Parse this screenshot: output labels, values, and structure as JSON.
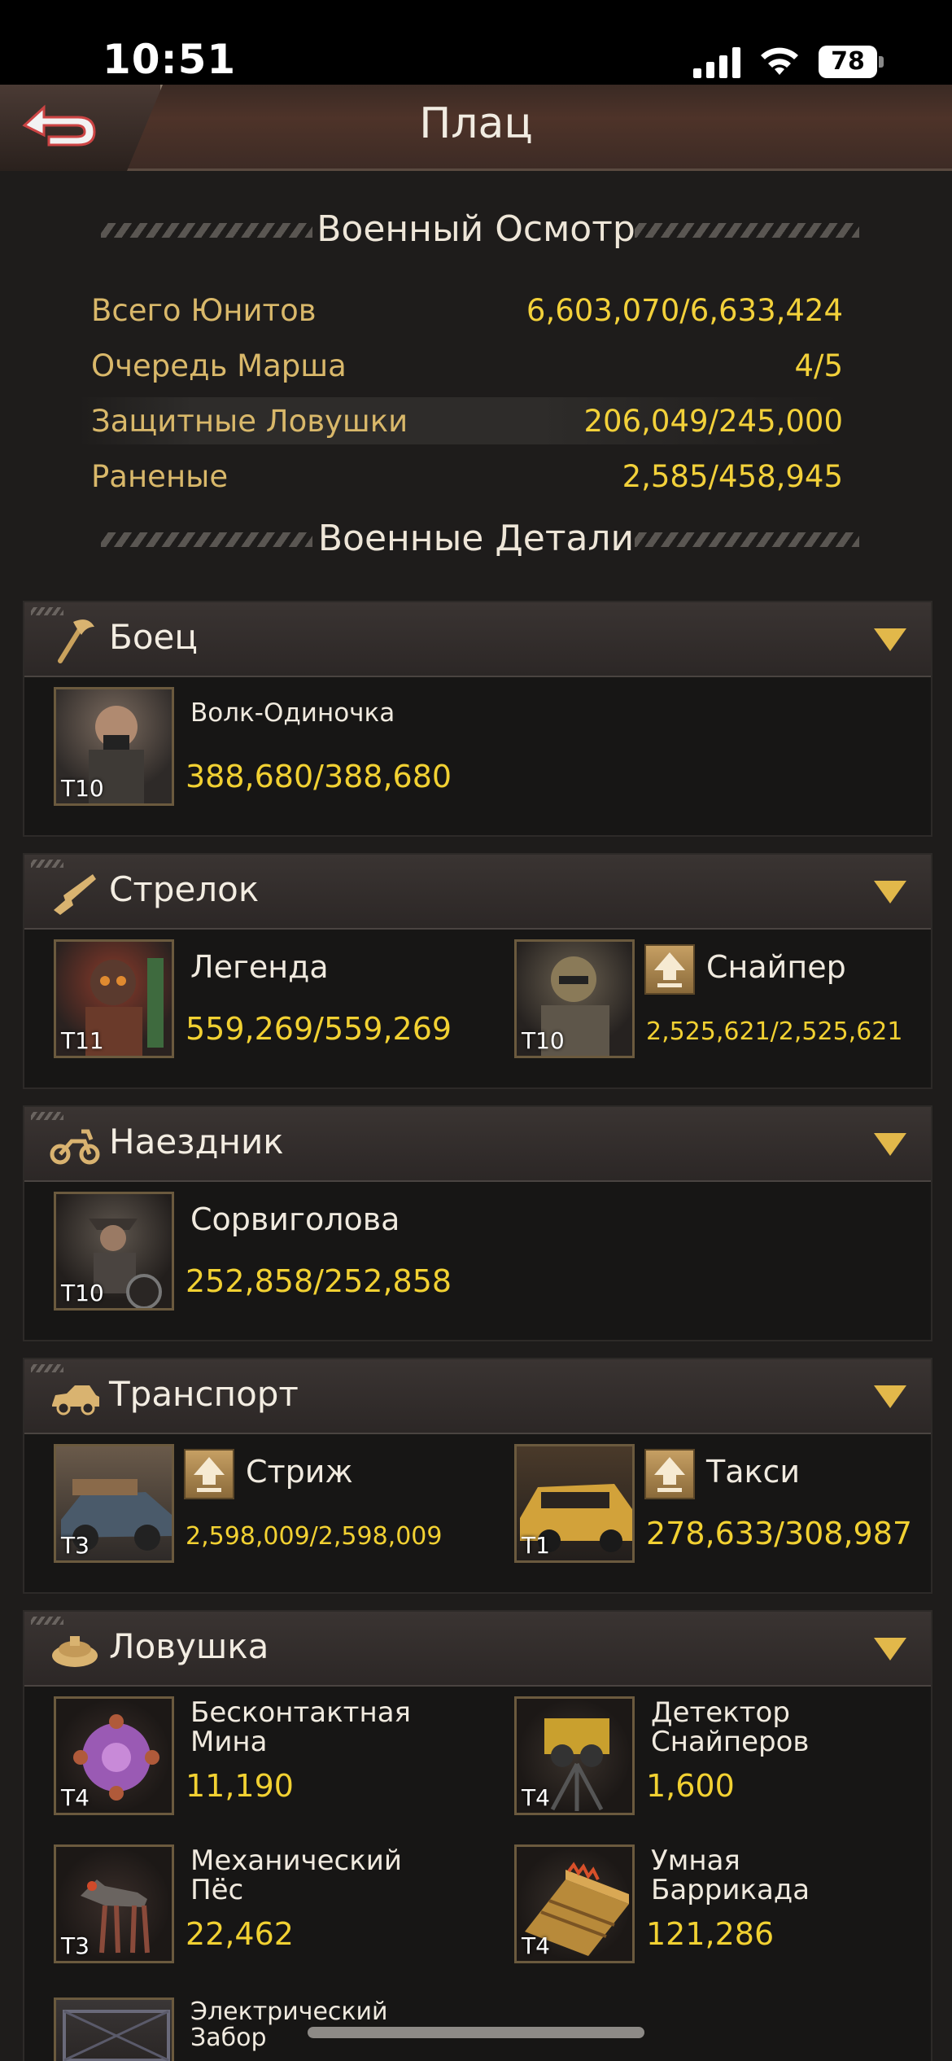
{
  "status": {
    "time": "10:51",
    "battery": "78"
  },
  "header": {
    "title": "Плац",
    "back_icon": "back-arrow-icon"
  },
  "overview": {
    "title": "Военный Осмотр",
    "stats": [
      {
        "label": "Всего Юнитов",
        "value": "6,603,070/6,633,424"
      },
      {
        "label": "Очередь Марша",
        "value": "4/5"
      },
      {
        "label": "Защитные Ловушки",
        "value": "206,049/245,000"
      },
      {
        "label": "Раненые",
        "value": "2,585/458,945"
      }
    ]
  },
  "details": {
    "title": "Военные Детали",
    "categories": [
      {
        "label": "Боец",
        "icon": "axe-icon",
        "units": [
          {
            "name": "Волк-Одиночка",
            "tier": "T10",
            "count": "388,680/388,680"
          }
        ]
      },
      {
        "label": "Стрелок",
        "icon": "rifle-icon",
        "units": [
          {
            "name": "Легенда",
            "tier": "T11",
            "count": "559,269/559,269"
          },
          {
            "name": "Снайпер",
            "tier": "T10",
            "count": "2,525,621/2,525,621"
          }
        ]
      },
      {
        "label": "Наездник",
        "icon": "motorcycle-icon",
        "units": [
          {
            "name": "Сорвиголова",
            "tier": "T10",
            "count": "252,858/252,858"
          }
        ]
      },
      {
        "label": "Транспорт",
        "icon": "car-icon",
        "units": [
          {
            "name": "Стриж",
            "tier": "T3",
            "count": "2,598,009/2,598,009"
          },
          {
            "name": "Такси",
            "tier": "T1",
            "count": "278,633/308,987"
          }
        ]
      },
      {
        "label": "Ловушка",
        "icon": "mine-icon",
        "units": [
          {
            "name": "Бесконтактная Мина",
            "tier": "T4",
            "count": "11,190"
          },
          {
            "name": "Детектор Снайперов",
            "tier": "T4",
            "count": "1,600"
          },
          {
            "name": "Механический Пёс",
            "tier": "T3",
            "count": "22,462"
          },
          {
            "name": "Умная Баррикада",
            "tier": "T4",
            "count": "121,286"
          },
          {
            "name": "Электрический Забор",
            "tier": "",
            "count": ""
          }
        ]
      }
    ]
  },
  "colors": {
    "gold": "#f2d132",
    "label_gold": "#d9b86a",
    "arrow": "#e2b84a"
  }
}
